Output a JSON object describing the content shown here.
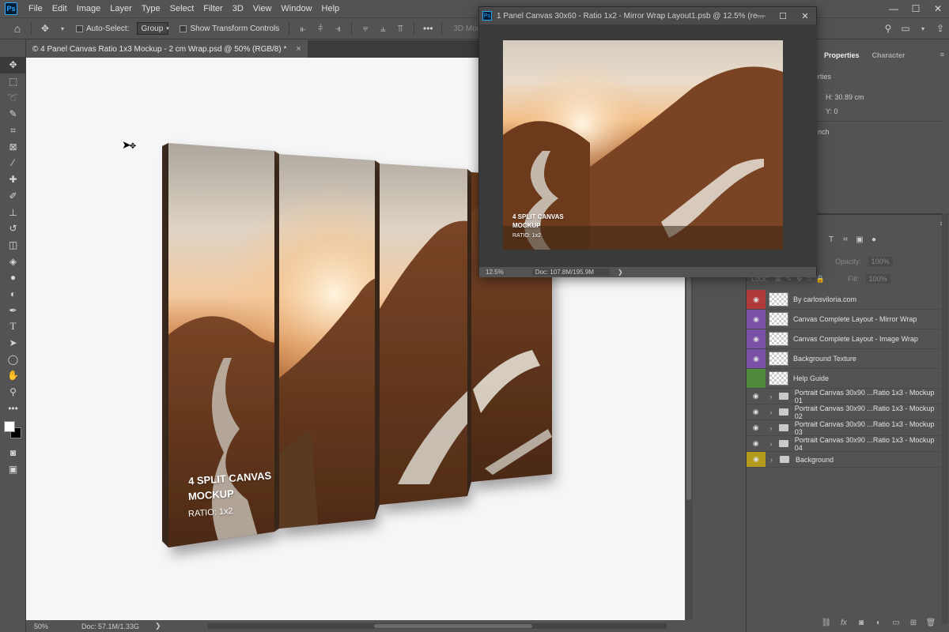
{
  "app": {
    "logo": "Ps"
  },
  "menu": [
    "File",
    "Edit",
    "Image",
    "Layer",
    "Type",
    "Select",
    "Filter",
    "3D",
    "View",
    "Window",
    "Help"
  ],
  "window_controls": {
    "minimize": "—",
    "restore": "☐",
    "close": "✕"
  },
  "options_bar": {
    "auto_select_label": "Auto-Select:",
    "auto_select_value": "Group",
    "show_transform_label": "Show Transform Controls",
    "mode_3d_label": "3D Mod"
  },
  "document": {
    "tab_title": "© 4 Panel Canvas Ratio 1x3 Mockup - 2 cm Wrap.psd @ 50% (RGB/8) *",
    "tab_close": "×",
    "zoom": "50%",
    "doc_size": "Doc: 57.1M/1.33G",
    "mockup_title_1": "4 SPLIT CANVAS",
    "mockup_title_2": "MOCKUP",
    "mockup_ratio": "RATIO:  1x2"
  },
  "floating_window": {
    "title": "1 Panel Canvas 30x60 - Ratio 1x2 - Mirror Wrap Layout1.psb @ 12.5% (re...",
    "zoom": "12.5%",
    "doc_size": "Doc: 107.8M/195.9M",
    "mockup_title_1": "4 SPLIT CANVAS",
    "mockup_title_2": "MOCKUP",
    "mockup_ratio": "RATIO:  1x2"
  },
  "properties_panel": {
    "tabs": [
      "Properties",
      "Character"
    ],
    "section_label": "erties",
    "h_value": "H:  30.89 cm",
    "y_value": "Y:  0",
    "unit_label": "nch"
  },
  "layers_panel": {
    "opacity_label": "Opacity:",
    "opacity_value": "100%",
    "fill_label": "Fill:",
    "fill_value": "100%",
    "lock_label": "Lock:",
    "layers": [
      {
        "name": "By carlosviloria.com",
        "color": "#b03a3a",
        "type": "layer"
      },
      {
        "name": "Canvas Complete Layout - Mirror Wrap",
        "color": "#7a4fa8",
        "type": "smart"
      },
      {
        "name": "Canvas Complete Layout - Image Wrap",
        "color": "#7a4fa8",
        "type": "smart"
      },
      {
        "name": "Background Texture",
        "color": "#7a4fa8",
        "type": "smart"
      },
      {
        "name": "Help Guide",
        "color": "#4f8a3a",
        "type": "layer"
      },
      {
        "name": "Portrait Canvas 30x90 ...Ratio 1x3 - Mockup 01",
        "color": "",
        "type": "group"
      },
      {
        "name": "Portrait Canvas 30x90 ...Ratio 1x3 - Mockup 02",
        "color": "",
        "type": "group"
      },
      {
        "name": "Portrait Canvas 30x90 ...Ratio 1x3 - Mockup 03",
        "color": "",
        "type": "group"
      },
      {
        "name": "Portrait Canvas 30x90 ...Ratio 1x3 - Mockup 04",
        "color": "",
        "type": "group"
      },
      {
        "name": "Background",
        "color": "#b39a1a",
        "type": "group"
      }
    ]
  }
}
